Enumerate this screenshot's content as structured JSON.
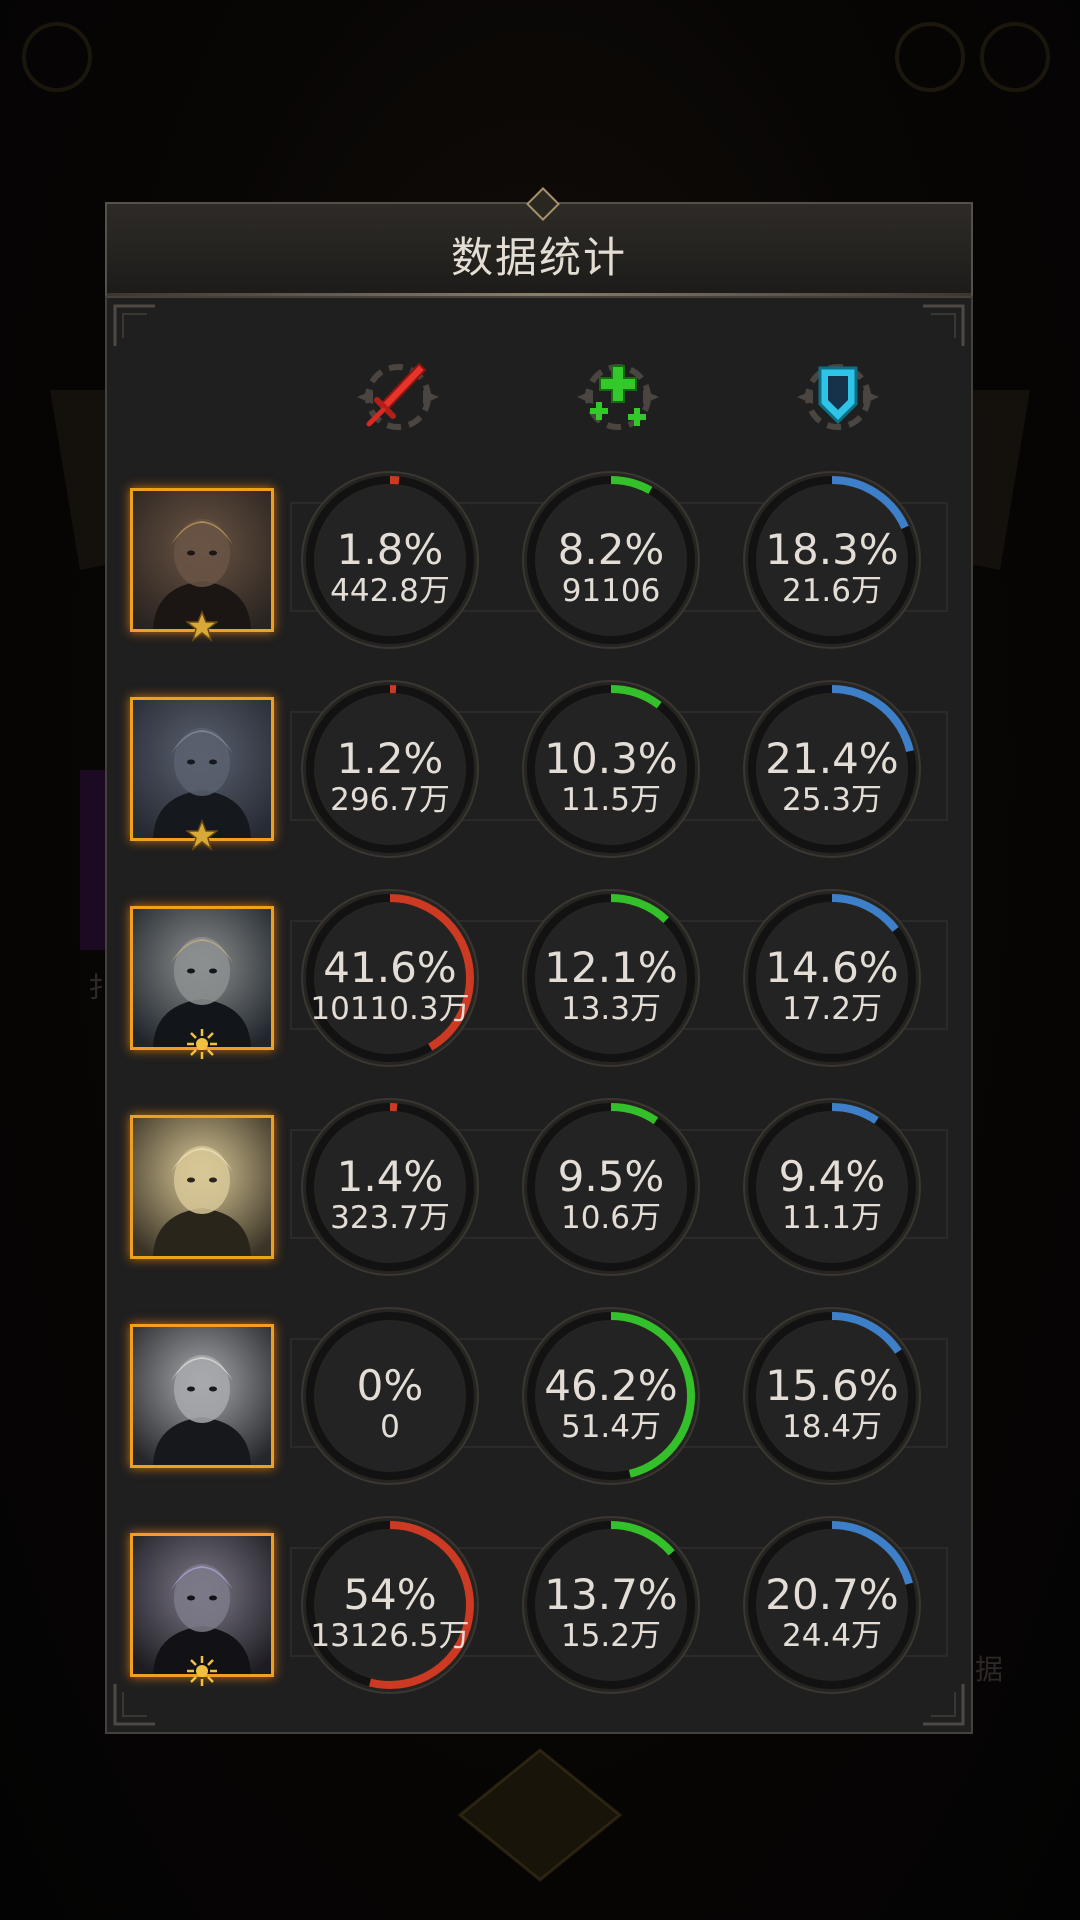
{
  "panel": {
    "title": "数据统计"
  },
  "columns": [
    {
      "key": "damage",
      "icon": "sword-icon",
      "color": "#e8332a"
    },
    {
      "key": "heal",
      "icon": "heal-cross-icon",
      "color": "#34c92a"
    },
    {
      "key": "defense",
      "icon": "shield-icon",
      "color": "#2ec4e8"
    }
  ],
  "ring_colors": {
    "damage": "#cc3a24",
    "heal": "#34c02a",
    "defense": "#3e7fc9"
  },
  "background": {
    "right_label": "据",
    "left_label": "扌"
  },
  "heroes": [
    {
      "portrait": "bearded-warrior-portrait",
      "badge": "star-badge-icon",
      "stats": [
        {
          "pct": "1.8%",
          "value": "442.8万",
          "fraction": 0.018
        },
        {
          "pct": "8.2%",
          "value": "91106",
          "fraction": 0.082
        },
        {
          "pct": "18.3%",
          "value": "21.6万",
          "fraction": 0.183
        }
      ]
    },
    {
      "portrait": "werewolf-portrait",
      "badge": "star-badge-icon",
      "stats": [
        {
          "pct": "1.2%",
          "value": "296.7万",
          "fraction": 0.012
        },
        {
          "pct": "10.3%",
          "value": "11.5万",
          "fraction": 0.103
        },
        {
          "pct": "21.4%",
          "value": "25.3万",
          "fraction": 0.214
        }
      ]
    },
    {
      "portrait": "elf-mage-portrait",
      "badge": "sun-badge-icon",
      "stats": [
        {
          "pct": "41.6%",
          "value": "10110.3万",
          "fraction": 0.416
        },
        {
          "pct": "12.1%",
          "value": "13.3万",
          "fraction": 0.121
        },
        {
          "pct": "14.6%",
          "value": "17.2万",
          "fraction": 0.146
        }
      ]
    },
    {
      "portrait": "blonde-elf-portrait",
      "badge": "moon-badge-icon",
      "stats": [
        {
          "pct": "1.4%",
          "value": "323.7万",
          "fraction": 0.014
        },
        {
          "pct": "9.5%",
          "value": "10.6万",
          "fraction": 0.095
        },
        {
          "pct": "9.4%",
          "value": "11.1万",
          "fraction": 0.094
        }
      ]
    },
    {
      "portrait": "silver-crowned-priestess-portrait",
      "badge": "moon-badge-icon",
      "stats": [
        {
          "pct": "0%",
          "value": "0",
          "fraction": 0
        },
        {
          "pct": "46.2%",
          "value": "51.4万",
          "fraction": 0.462
        },
        {
          "pct": "15.6%",
          "value": "18.4万",
          "fraction": 0.156
        }
      ]
    },
    {
      "portrait": "grey-haired-rogue-portrait",
      "badge": "sun-badge-icon",
      "stats": [
        {
          "pct": "54%",
          "value": "13126.5万",
          "fraction": 0.54
        },
        {
          "pct": "13.7%",
          "value": "15.2万",
          "fraction": 0.137
        },
        {
          "pct": "20.7%",
          "value": "24.4万",
          "fraction": 0.207
        }
      ]
    }
  ]
}
